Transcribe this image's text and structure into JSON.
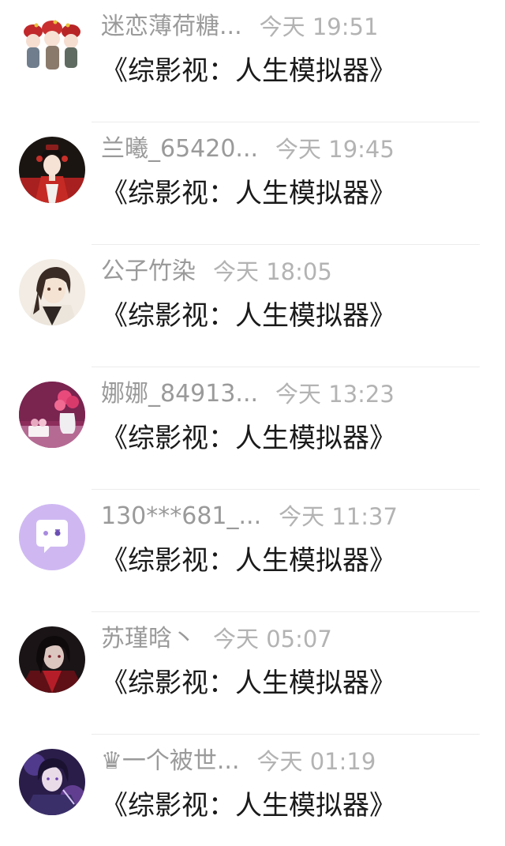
{
  "messages": [
    {
      "name": "迷恋薄荷糖...",
      "time": "今天 19:51",
      "text": "《综影视：人生模拟器》",
      "avatar": "chibi-group-avatar"
    },
    {
      "name": "兰曦_65420...",
      "time": "今天 19:45",
      "text": "《综影视：人生模拟器》",
      "avatar": "red-robe-woman-avatar"
    },
    {
      "name": "公子竹染",
      "time": "今天 18:05",
      "text": "《综影视：人生模拟器》",
      "avatar": "anime-man-avatar"
    },
    {
      "name": "娜娜_84913...",
      "time": "今天 13:23",
      "text": "《综影视：人生模拟器》",
      "avatar": "flowers-still-life-avatar"
    },
    {
      "name": "130***681_...",
      "time": "今天 11:37",
      "text": "《综影视：人生模拟器》",
      "avatar": "chat-bubble-default-avatar"
    },
    {
      "name": "苏瑾晗丶",
      "time": "今天 05:07",
      "text": "《综影视：人生模拟器》",
      "avatar": "dark-anime-man-avatar"
    },
    {
      "name": "♛一个被世...",
      "time": "今天 01:19",
      "text": "《综影视：人生模拟器》",
      "avatar": "purple-anime-man-avatar"
    }
  ],
  "colors": {
    "name": "#9a9a9a",
    "time": "#b3b3b3",
    "message": "#1a1a1a",
    "divider": "#ececec"
  }
}
